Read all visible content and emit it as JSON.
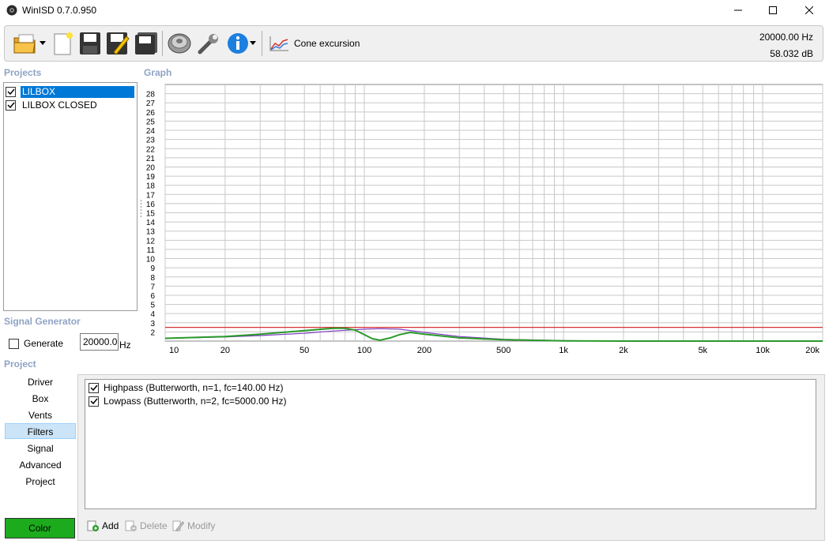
{
  "window": {
    "title": "WinISD 0.7.0.950"
  },
  "toolbar": {
    "cone_excursion_label": "Cone excursion",
    "readout_frequency": "20000.00 Hz",
    "readout_level": "58.032 dB"
  },
  "sections": {
    "projects": "Projects",
    "graph": "Graph",
    "signal_generator": "Signal Generator",
    "project": "Project"
  },
  "projects": [
    {
      "name": "LILBOX",
      "checked": true,
      "selected": true
    },
    {
      "name": "LILBOX CLOSED",
      "checked": true,
      "selected": false
    }
  ],
  "signal_generator": {
    "generate_label": "Generate",
    "generate_checked": false,
    "frequency_value": "20000.0",
    "unit": "Hz"
  },
  "project_nav": [
    "Driver",
    "Box",
    "Vents",
    "Filters",
    "Signal",
    "Advanced",
    "Project"
  ],
  "project_nav_selected": "Filters",
  "color_button_label": "Color",
  "color_button_color": "#1cab1c",
  "filters": [
    {
      "label": "Highpass (Butterworth, n=1, fc=140.00 Hz)",
      "checked": true
    },
    {
      "label": "Lowpass (Butterworth, n=2, fc=5000.00 Hz)",
      "checked": true
    }
  ],
  "filter_actions": {
    "add": "Add",
    "delete": "Delete",
    "modify": "Modify"
  },
  "chart_data": {
    "type": "line",
    "x_scale": "log",
    "xlim": [
      10,
      20000
    ],
    "ylim": [
      1,
      29
    ],
    "x_tick_labels": [
      "10",
      "20",
      "50",
      "100",
      "200",
      "500",
      "1k",
      "2k",
      "5k",
      "10k",
      "20k"
    ],
    "x_tick_values": [
      10,
      20,
      50,
      100,
      200,
      500,
      1000,
      2000,
      5000,
      10000,
      20000
    ],
    "y_tick_labels": [
      "2",
      "3",
      "4",
      "5",
      "6",
      "7",
      "8",
      "9",
      "10",
      "11",
      "12",
      "13",
      "14",
      "15",
      "16",
      "17",
      "18",
      "19",
      "20",
      "21",
      "22",
      "23",
      "24",
      "25",
      "26",
      "27",
      "28"
    ],
    "grid": true,
    "series": [
      {
        "color": "#d23232",
        "x": [
          10,
          20000
        ],
        "y": [
          2.5,
          2.5
        ]
      },
      {
        "color": "#8040c0",
        "x": [
          10,
          20,
          30,
          50,
          70,
          100,
          120,
          150,
          200,
          300,
          500,
          1000,
          2000,
          20000
        ],
        "y": [
          1.3,
          1.45,
          1.6,
          1.85,
          2.1,
          2.3,
          2.35,
          2.3,
          1.95,
          1.5,
          1.2,
          1.05,
          1.0,
          1.0
        ]
      },
      {
        "color": "#2a9a2a",
        "x": [
          10,
          20,
          30,
          50,
          70,
          80,
          90,
          100,
          110,
          120,
          135,
          150,
          170,
          200,
          300,
          500,
          1000,
          2000,
          20000
        ],
        "y": [
          1.3,
          1.5,
          1.75,
          2.15,
          2.4,
          2.4,
          2.2,
          1.7,
          1.25,
          1.1,
          1.35,
          1.7,
          1.95,
          1.75,
          1.35,
          1.15,
          1.03,
          1.0,
          1.0
        ]
      }
    ]
  }
}
